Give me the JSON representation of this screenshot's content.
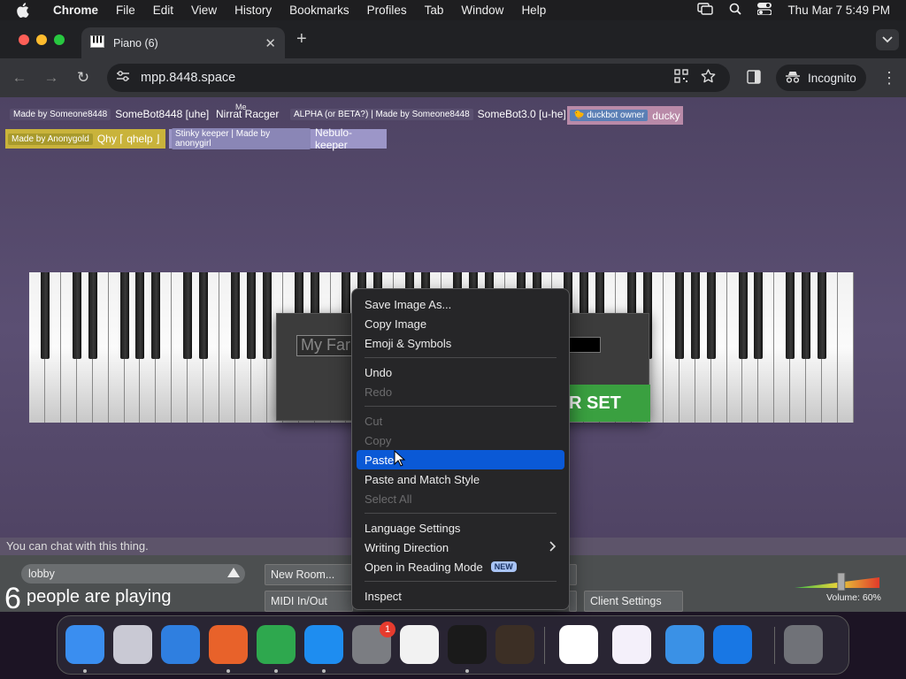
{
  "menubar": {
    "items": [
      "Chrome",
      "File",
      "Edit",
      "View",
      "History",
      "Bookmarks",
      "Profiles",
      "Tab",
      "Window",
      "Help"
    ],
    "clock": "Thu Mar 7  5:49 PM"
  },
  "browser": {
    "tab_title": "Piano (6)",
    "url": "mpp.8448.space",
    "incognito_label": "Incognito"
  },
  "page": {
    "users": [
      {
        "tag": "Made by Someone8448",
        "name": "SomeBot8448 [uhe]",
        "tag_bg": "#5a5070",
        "name_bg": "transparent"
      },
      {
        "tag": "",
        "name": "Nirrat Racger",
        "tag_bg": "",
        "name_bg": "transparent"
      },
      {
        "tag": "ALPHA (or BETA?) | Made by Someone8448",
        "name": "SomeBot3.0 [u-he]",
        "tag_bg": "#5a5070",
        "name_bg": "transparent"
      },
      {
        "tag": "🐤 duckbot owner",
        "name": "ducky",
        "tag_bg": "#5b7fb5",
        "name_bg": "#b98aa8"
      },
      {
        "tag": "Made by Anonygold",
        "name": "Qhy ⌈ qhelp ⌋",
        "tag_bg": "#a89a2c",
        "name_bg": "#c9b33b"
      },
      {
        "tag": "Stinky keeper | Made by anonygirl",
        "name": "Nebulo-keeper",
        "tag_bg": "#8a86b6",
        "name_bg": "#9c96c8"
      }
    ],
    "crown_label": "Me",
    "modal": {
      "name_value": "My Far",
      "set_button": "R SET"
    },
    "chat_hint": "You can chat with this thing.",
    "room": "lobby",
    "people_count": "6",
    "people_label": "people are playing",
    "buttons": {
      "new_room": "New Room...",
      "midi": "MIDI In/Out",
      "client_settings": "Client Settings"
    },
    "volume_label": "Volume: 60%",
    "volume_level": 0.6
  },
  "context_menu": {
    "items": [
      {
        "label": "Save Image As...",
        "state": "normal"
      },
      {
        "label": "Copy Image",
        "state": "normal"
      },
      {
        "label": "Emoji & Symbols",
        "state": "normal"
      },
      {
        "sep": true
      },
      {
        "label": "Undo",
        "state": "normal"
      },
      {
        "label": "Redo",
        "state": "disabled"
      },
      {
        "sep": true
      },
      {
        "label": "Cut",
        "state": "disabled"
      },
      {
        "label": "Copy",
        "state": "disabled"
      },
      {
        "label": "Paste",
        "state": "active"
      },
      {
        "label": "Paste and Match Style",
        "state": "normal"
      },
      {
        "label": "Select All",
        "state": "disabled"
      },
      {
        "sep": true
      },
      {
        "label": "Language Settings",
        "state": "normal"
      },
      {
        "label": "Writing Direction",
        "state": "normal",
        "submenu": true
      },
      {
        "label": "Open in Reading Mode",
        "state": "normal",
        "badge": "NEW"
      },
      {
        "sep": true
      },
      {
        "label": "Inspect",
        "state": "normal"
      }
    ]
  },
  "dock": {
    "apps": [
      {
        "name": "finder-icon",
        "color": "#3a8ef0",
        "dot": true
      },
      {
        "name": "launchpad-icon",
        "color": "#c9c9d4",
        "dot": false
      },
      {
        "name": "safari-icon",
        "color": "#2f7fe0",
        "dot": false
      },
      {
        "name": "firefox-icon",
        "color": "#e8622a",
        "dot": true
      },
      {
        "name": "chrome-icon",
        "color": "#2ea84e",
        "dot": true
      },
      {
        "name": "app-store-icon",
        "color": "#1e8df0",
        "dot": true
      },
      {
        "name": "system-settings-icon",
        "color": "#7b7d82",
        "dot": false,
        "badge": "1"
      },
      {
        "name": "textedit-icon",
        "color": "#f2f2f2",
        "dot": false
      },
      {
        "name": "terminal-icon",
        "color": "#1a1a1a",
        "dot": true
      },
      {
        "name": "garageband-icon",
        "color": "#3c2f25",
        "dot": false
      },
      {
        "name": "vscode-icon",
        "color": "#ffffff",
        "dot": false
      },
      {
        "name": "visual-studio-icon",
        "color": "#f4f0fa",
        "dot": false
      },
      {
        "name": "weather-icon",
        "color": "#3a91e6",
        "dot": false
      },
      {
        "name": "xcode-icon",
        "color": "#1877e4",
        "dot": false
      },
      {
        "name": "trash-icon",
        "color": "#707278",
        "dot": false
      }
    ]
  }
}
